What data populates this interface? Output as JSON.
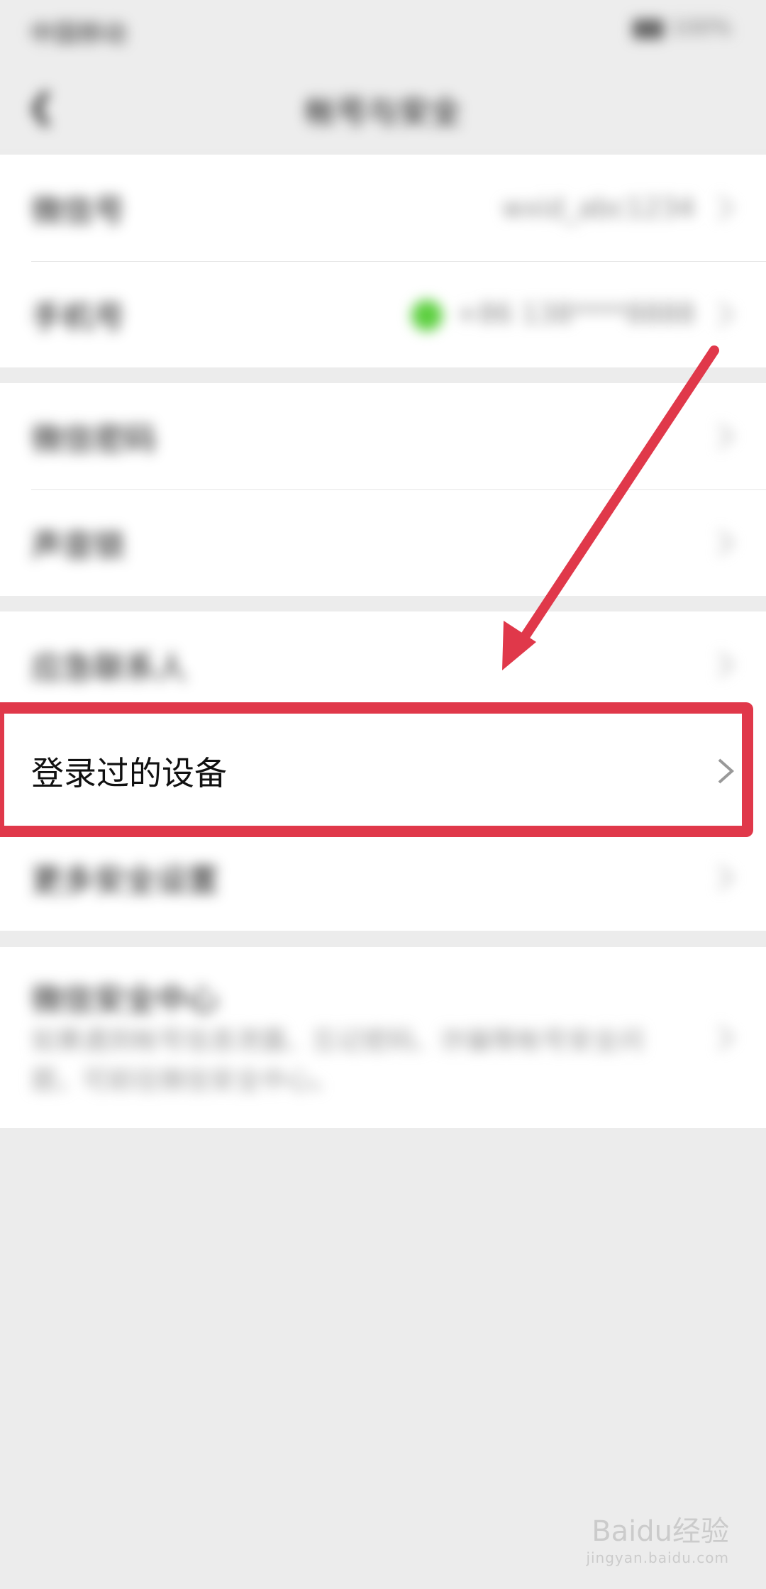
{
  "status_bar": {
    "left_text": "中国移动",
    "battery_text": "100%"
  },
  "nav": {
    "title": "帐号与安全"
  },
  "rows": {
    "wechat_id": {
      "label": "微信号",
      "value": "wxid_abc1234"
    },
    "phone": {
      "label": "手机号",
      "value": "+86 138****8888"
    },
    "voice_lock": {
      "label": "微信密码"
    },
    "voiceprint": {
      "label": "声音锁"
    },
    "emergency_contact": {
      "label": "应急联系人"
    },
    "login_devices": {
      "label": "登录过的设备"
    },
    "more_security": {
      "label": "更多安全设置"
    },
    "security_center": {
      "label": "微信安全中心",
      "description": "如果遇到帐号信息泄露、忘记密码、诈骗等帐号安全问题，可前往微信安全中心。"
    }
  },
  "colors": {
    "highlight": "#e0384a",
    "arrow": "#e0384a",
    "status_green": "#5ccf3f"
  },
  "watermark": {
    "text": "Baidu经验",
    "sub": "jingyan.baidu.com"
  }
}
